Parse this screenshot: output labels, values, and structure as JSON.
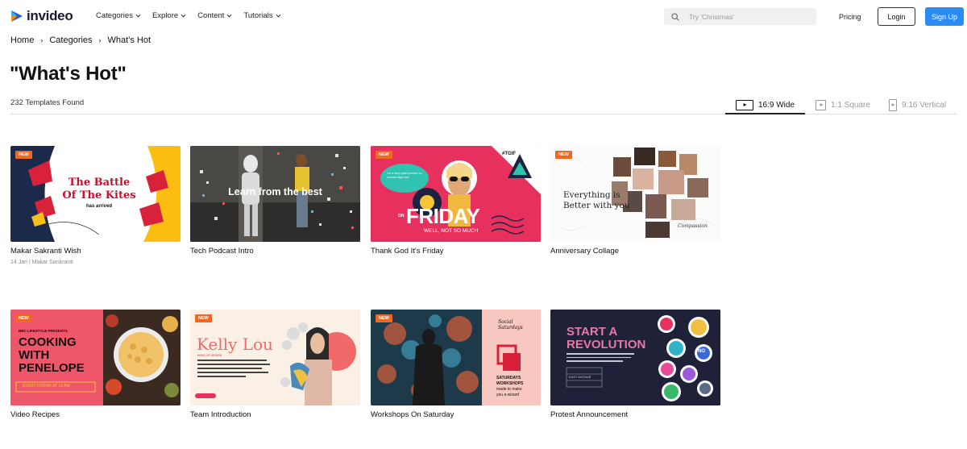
{
  "header": {
    "logo_text": "invideo",
    "nav": [
      {
        "label": "Categories"
      },
      {
        "label": "Explore"
      },
      {
        "label": "Content"
      },
      {
        "label": "Tutorials"
      }
    ],
    "search_placeholder": "Try 'Christmas'",
    "pricing_label": "Pricing",
    "login_label": "Login",
    "signup_label": "Sign Up",
    "accent_color": "#2a8bf2"
  },
  "breadcrumb": {
    "items": [
      "Home",
      "Categories",
      "What's Hot"
    ],
    "separator": "›"
  },
  "page": {
    "title": "\"What's Hot\"",
    "count": "232 Templates Found"
  },
  "aspect_tabs": [
    {
      "label": "16:9 Wide",
      "active": true
    },
    {
      "label": "1:1 Square",
      "active": false
    },
    {
      "label": "9:16 Vertical",
      "active": false
    }
  ],
  "badge_label": "NEW",
  "templates": [
    {
      "title": "Makar Sakranti Wish",
      "subtitle": "14 Jan | Makar Sankranti",
      "new": true,
      "thumb_text": [
        "The Battle",
        "Of The Kites",
        "has arrived"
      ]
    },
    {
      "title": "Tech Podcast Intro",
      "subtitle": "",
      "new": false,
      "thumb_text": [
        "Learn from the best"
      ]
    },
    {
      "title": "Thank God It's Friday",
      "subtitle": "",
      "new": true,
      "thumb_text": [
        "#TGIF",
        "ON",
        "FRIDAY",
        "WELL, NOT SO MUCH",
        "I'm a very quiet person on normal days but"
      ]
    },
    {
      "title": "Anniversary Collage",
      "subtitle": "",
      "new": true,
      "thumb_text": [
        "Everything is",
        "Better with you",
        "Compassion"
      ]
    },
    {
      "title": "Video Recipes",
      "subtitle": "",
      "new": true,
      "thumb_text": [
        "BBC LIFESTYLE PRESENTS",
        "COOKING",
        "WITH",
        "PENELOPE",
        "EVERY FRIDAY AT 12 AM"
      ]
    },
    {
      "title": "Team Introduction",
      "subtitle": "",
      "new": true,
      "thumb_text": [
        "Kelly Lou",
        "HEAD OF DESIGN"
      ]
    },
    {
      "title": "Workshops On Saturday",
      "subtitle": "",
      "new": true,
      "thumb_text": [
        "Social Saturdays",
        "SATURDAYS",
        "WORKSHOPS",
        "made to make you a wizard"
      ]
    },
    {
      "title": "Protest Announcement",
      "subtitle": "",
      "new": false,
      "thumb_text": [
        "START A",
        "REVOLUTION",
        "NO",
        "EAST AVENUE"
      ]
    }
  ]
}
